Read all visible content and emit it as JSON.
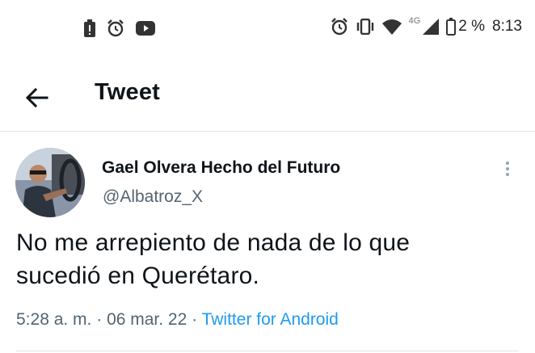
{
  "status_bar": {
    "left_icons": [
      "alert-battery-icon",
      "alarm-icon",
      "youtube-icon"
    ],
    "right_icons": [
      "alarm-icon",
      "vibrate-icon",
      "wifi-icon",
      "signal-icon",
      "battery-icon"
    ],
    "network": "4G",
    "battery": "2 %",
    "time": "8:13"
  },
  "header": {
    "title": "Tweet",
    "back_icon": "arrow-left-icon"
  },
  "tweet": {
    "author": "Gael Olvera Hecho del Futuro",
    "handle": "@Albatroz_X",
    "text_line1": "No me arrepiento de nada de lo que",
    "text_line2": "sucedió en Querétaro.",
    "time": "5:28 a. m.",
    "sep1": " · ",
    "date": "06 mar. 22",
    "sep2": " · ",
    "source": "Twitter for Android",
    "more_icon": "more-vertical-icon"
  },
  "colors": {
    "accent": "#1d9bf0",
    "secondary_text": "#536471",
    "primary_text": "#0f1419"
  }
}
